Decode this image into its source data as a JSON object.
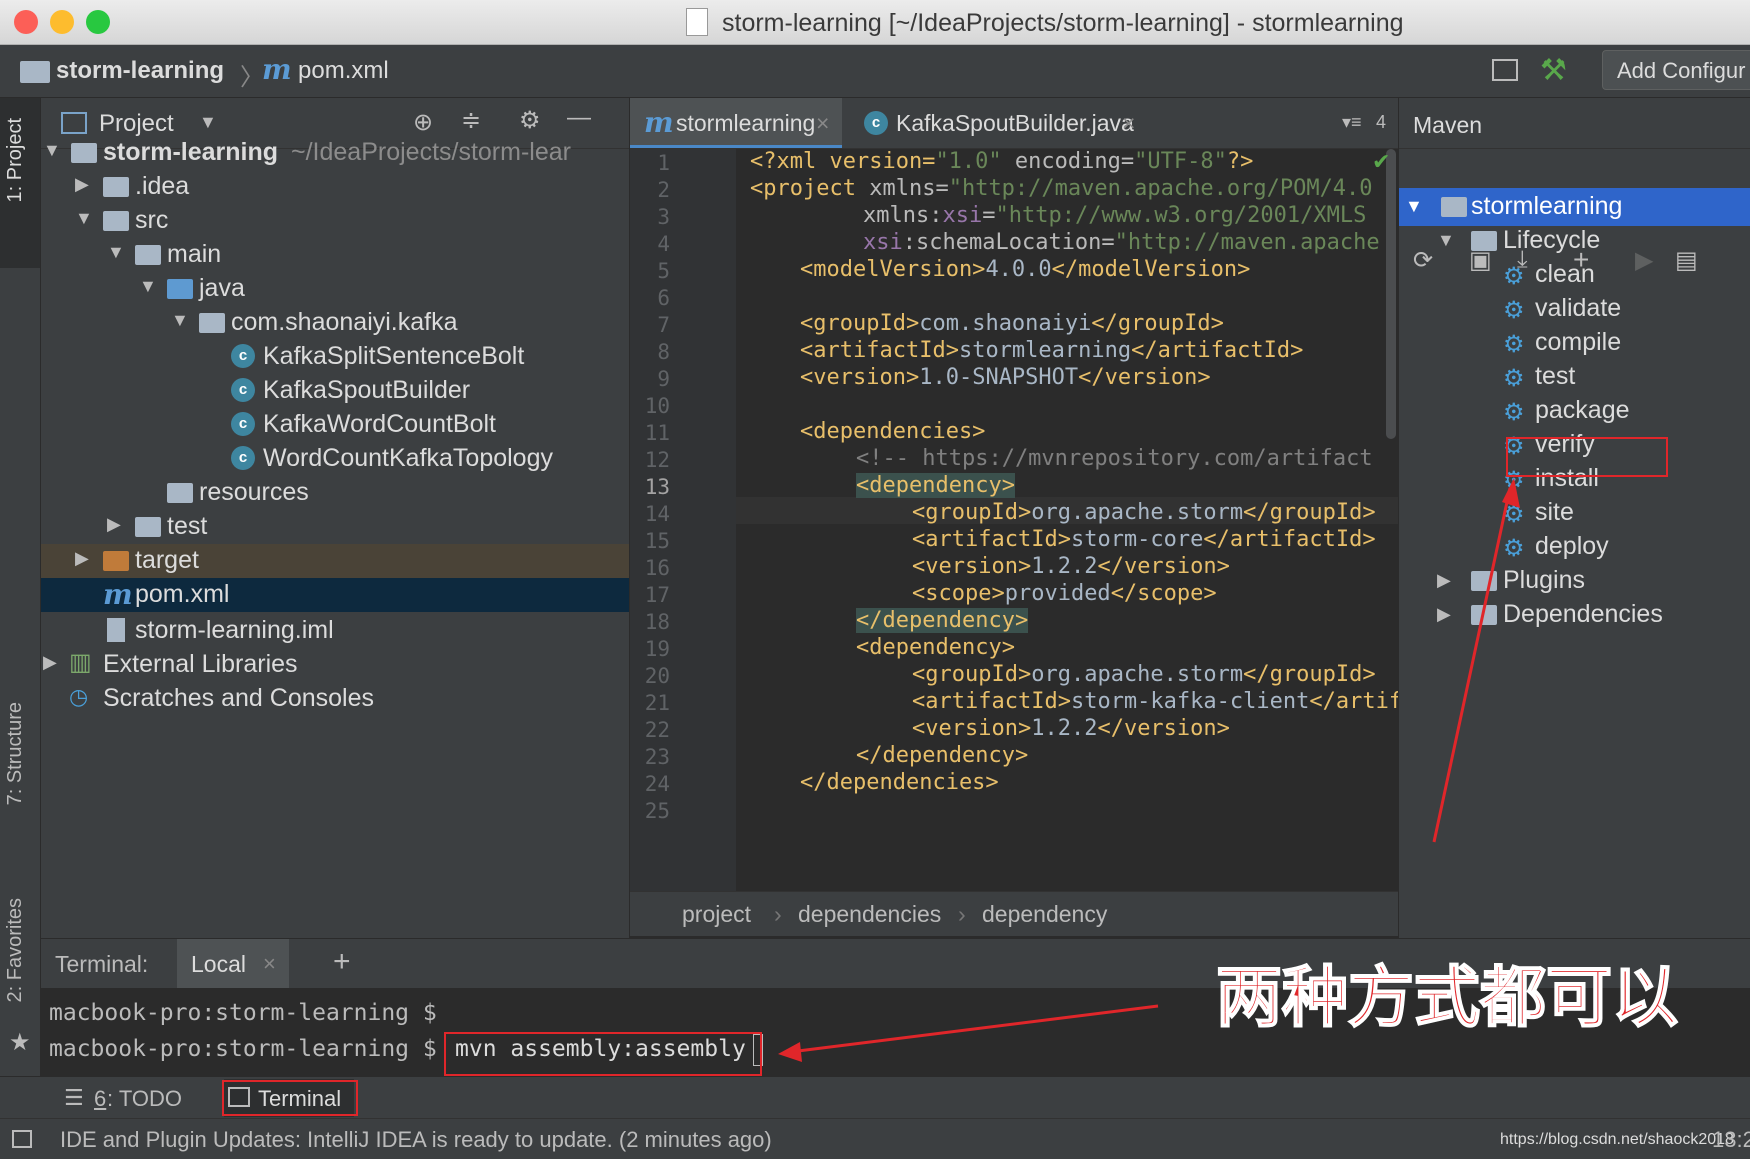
{
  "window": {
    "title": "storm-learning [~/IdeaProjects/storm-learning] - stormlearning"
  },
  "nav": {
    "project": "storm-learning",
    "file": "pom.xml",
    "add_config": "Add Configur"
  },
  "side_tabs": {
    "project": "1: Project",
    "structure": "7: Structure",
    "favorites": "2: Favorites"
  },
  "project_panel": {
    "title": "Project",
    "tree": [
      {
        "label": "storm-learning",
        "path": "~/IdeaProjects/storm-lear"
      },
      {
        "label": ".idea"
      },
      {
        "label": "src"
      },
      {
        "label": "main"
      },
      {
        "label": "java"
      },
      {
        "label": "com.shaonaiyi.kafka"
      },
      {
        "label": "KafkaSplitSentenceBolt"
      },
      {
        "label": "KafkaSpoutBuilder"
      },
      {
        "label": "KafkaWordCountBolt"
      },
      {
        "label": "WordCountKafkaTopology"
      },
      {
        "label": "resources"
      },
      {
        "label": "test"
      },
      {
        "label": "target"
      },
      {
        "label": "pom.xml"
      },
      {
        "label": "storm-learning.iml"
      },
      {
        "label": "External Libraries"
      },
      {
        "label": "Scratches and Consoles"
      }
    ]
  },
  "editor": {
    "tabs": [
      {
        "label": "stormlearning"
      },
      {
        "label": "KafkaSpoutBuilder.java"
      }
    ],
    "tab_count": "4",
    "lines": [
      "1",
      "2",
      "3",
      "4",
      "5",
      "6",
      "7",
      "8",
      "9",
      "10",
      "11",
      "12",
      "13",
      "14",
      "15",
      "16",
      "17",
      "18",
      "19",
      "20",
      "21",
      "22",
      "23",
      "24",
      "25"
    ],
    "code": {
      "l1a": "<?xml version=",
      "l1b": "\"1.0\"",
      "l1c": " encoding=",
      "l1d": "\"UTF-8\"",
      "l1e": "?>",
      "l2a": "<project ",
      "l2b": "xmlns=",
      "l2c": "\"http://maven.apache.org/POM/4.0",
      "l3a": "xmlns:",
      "l3b": "xsi",
      "l3c": "=",
      "l3d": "\"http://www.w3.org/2001/XMLS",
      "l4a": "xsi",
      "l4b": ":schemaLocation=",
      "l4c": "\"http://maven.apache",
      "l5a": "<modelVersion>",
      "l5b": "4.0.0",
      "l5c": "</modelVersion>",
      "l7a": "<groupId>",
      "l7b": "com.shaonaiyi",
      "l7c": "</groupId>",
      "l8a": "<artifactId>",
      "l8b": "stormlearning",
      "l8c": "</artifactId>",
      "l9a": "<version>",
      "l9b": "1.0-SNAPSHOT",
      "l9c": "</version>",
      "l11": "<dependencies>",
      "l12": "<!-- https://mvnrepository.com/artifact",
      "l13": "<dependency>",
      "l14a": "<groupId>",
      "l14b": "org.apache.storm",
      "l14c": "</groupId>",
      "l15a": "<artifactId>",
      "l15b": "storm-core",
      "l15c": "</artifactId>",
      "l16a": "<version>",
      "l16b": "1.2.2",
      "l16c": "</version>",
      "l17a": "<scope>",
      "l17b": "provided",
      "l17c": "</scope>",
      "l18": "</dependency>",
      "l19": "<dependency>",
      "l20a": "<groupId>",
      "l20b": "org.apache.storm",
      "l20c": "</groupId>",
      "l21a": "<artifactId>",
      "l21b": "storm-kafka-client",
      "l21c": "</artifactId>",
      "l22a": "<version>",
      "l22b": "1.2.2",
      "l22c": "</version>",
      "l23": "</dependency>",
      "l24": "</dependencies>"
    },
    "breadcrumbs": [
      "project",
      "dependencies",
      "dependency"
    ]
  },
  "maven": {
    "title": "Maven",
    "root": "stormlearning",
    "lifecycle": "Lifecycle",
    "goals": [
      "clean",
      "validate",
      "compile",
      "test",
      "package",
      "verify",
      "install",
      "site",
      "deploy"
    ],
    "plugins": "Plugins",
    "dependencies": "Dependencies"
  },
  "terminal": {
    "label": "Terminal:",
    "tab": "Local",
    "prompt1": "macbook-pro:storm-learning $",
    "prompt2": "macbook-pro:storm-learning $",
    "command": "mvn assembly:assembly"
  },
  "annotation": "两种方式都可以",
  "bottom_tabs": {
    "todo_num": "6",
    "todo_rest": ": TODO",
    "terminal": "Terminal"
  },
  "status": {
    "message": "IDE and Plugin Updates: IntelliJ IDEA is ready to update. (2 minutes ago)",
    "watermark": "https://blog.csdn.net/shaock2018",
    "time": "13:2"
  },
  "colors": {
    "accent": "#4a88c7",
    "selection": "#0d293e",
    "annotation_red": "#e0262a"
  }
}
